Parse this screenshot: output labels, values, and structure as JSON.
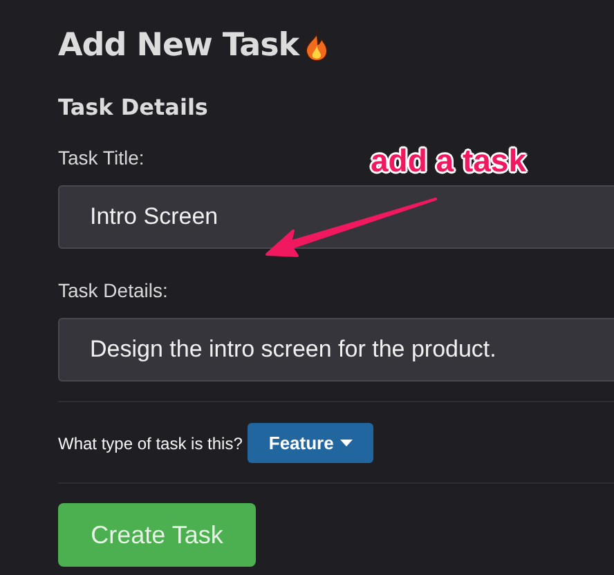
{
  "page": {
    "title": "Add New Task"
  },
  "section": {
    "heading": "Task Details"
  },
  "fields": [
    {
      "label": "Task Title:",
      "value": "Intro Screen"
    },
    {
      "label": "Task Details:",
      "value": "Design the intro screen for the product."
    }
  ],
  "task_type": {
    "label": "What type of task is this?",
    "value": "Feature"
  },
  "submit_button": "Create Task",
  "annotation": {
    "text": "add a task"
  }
}
